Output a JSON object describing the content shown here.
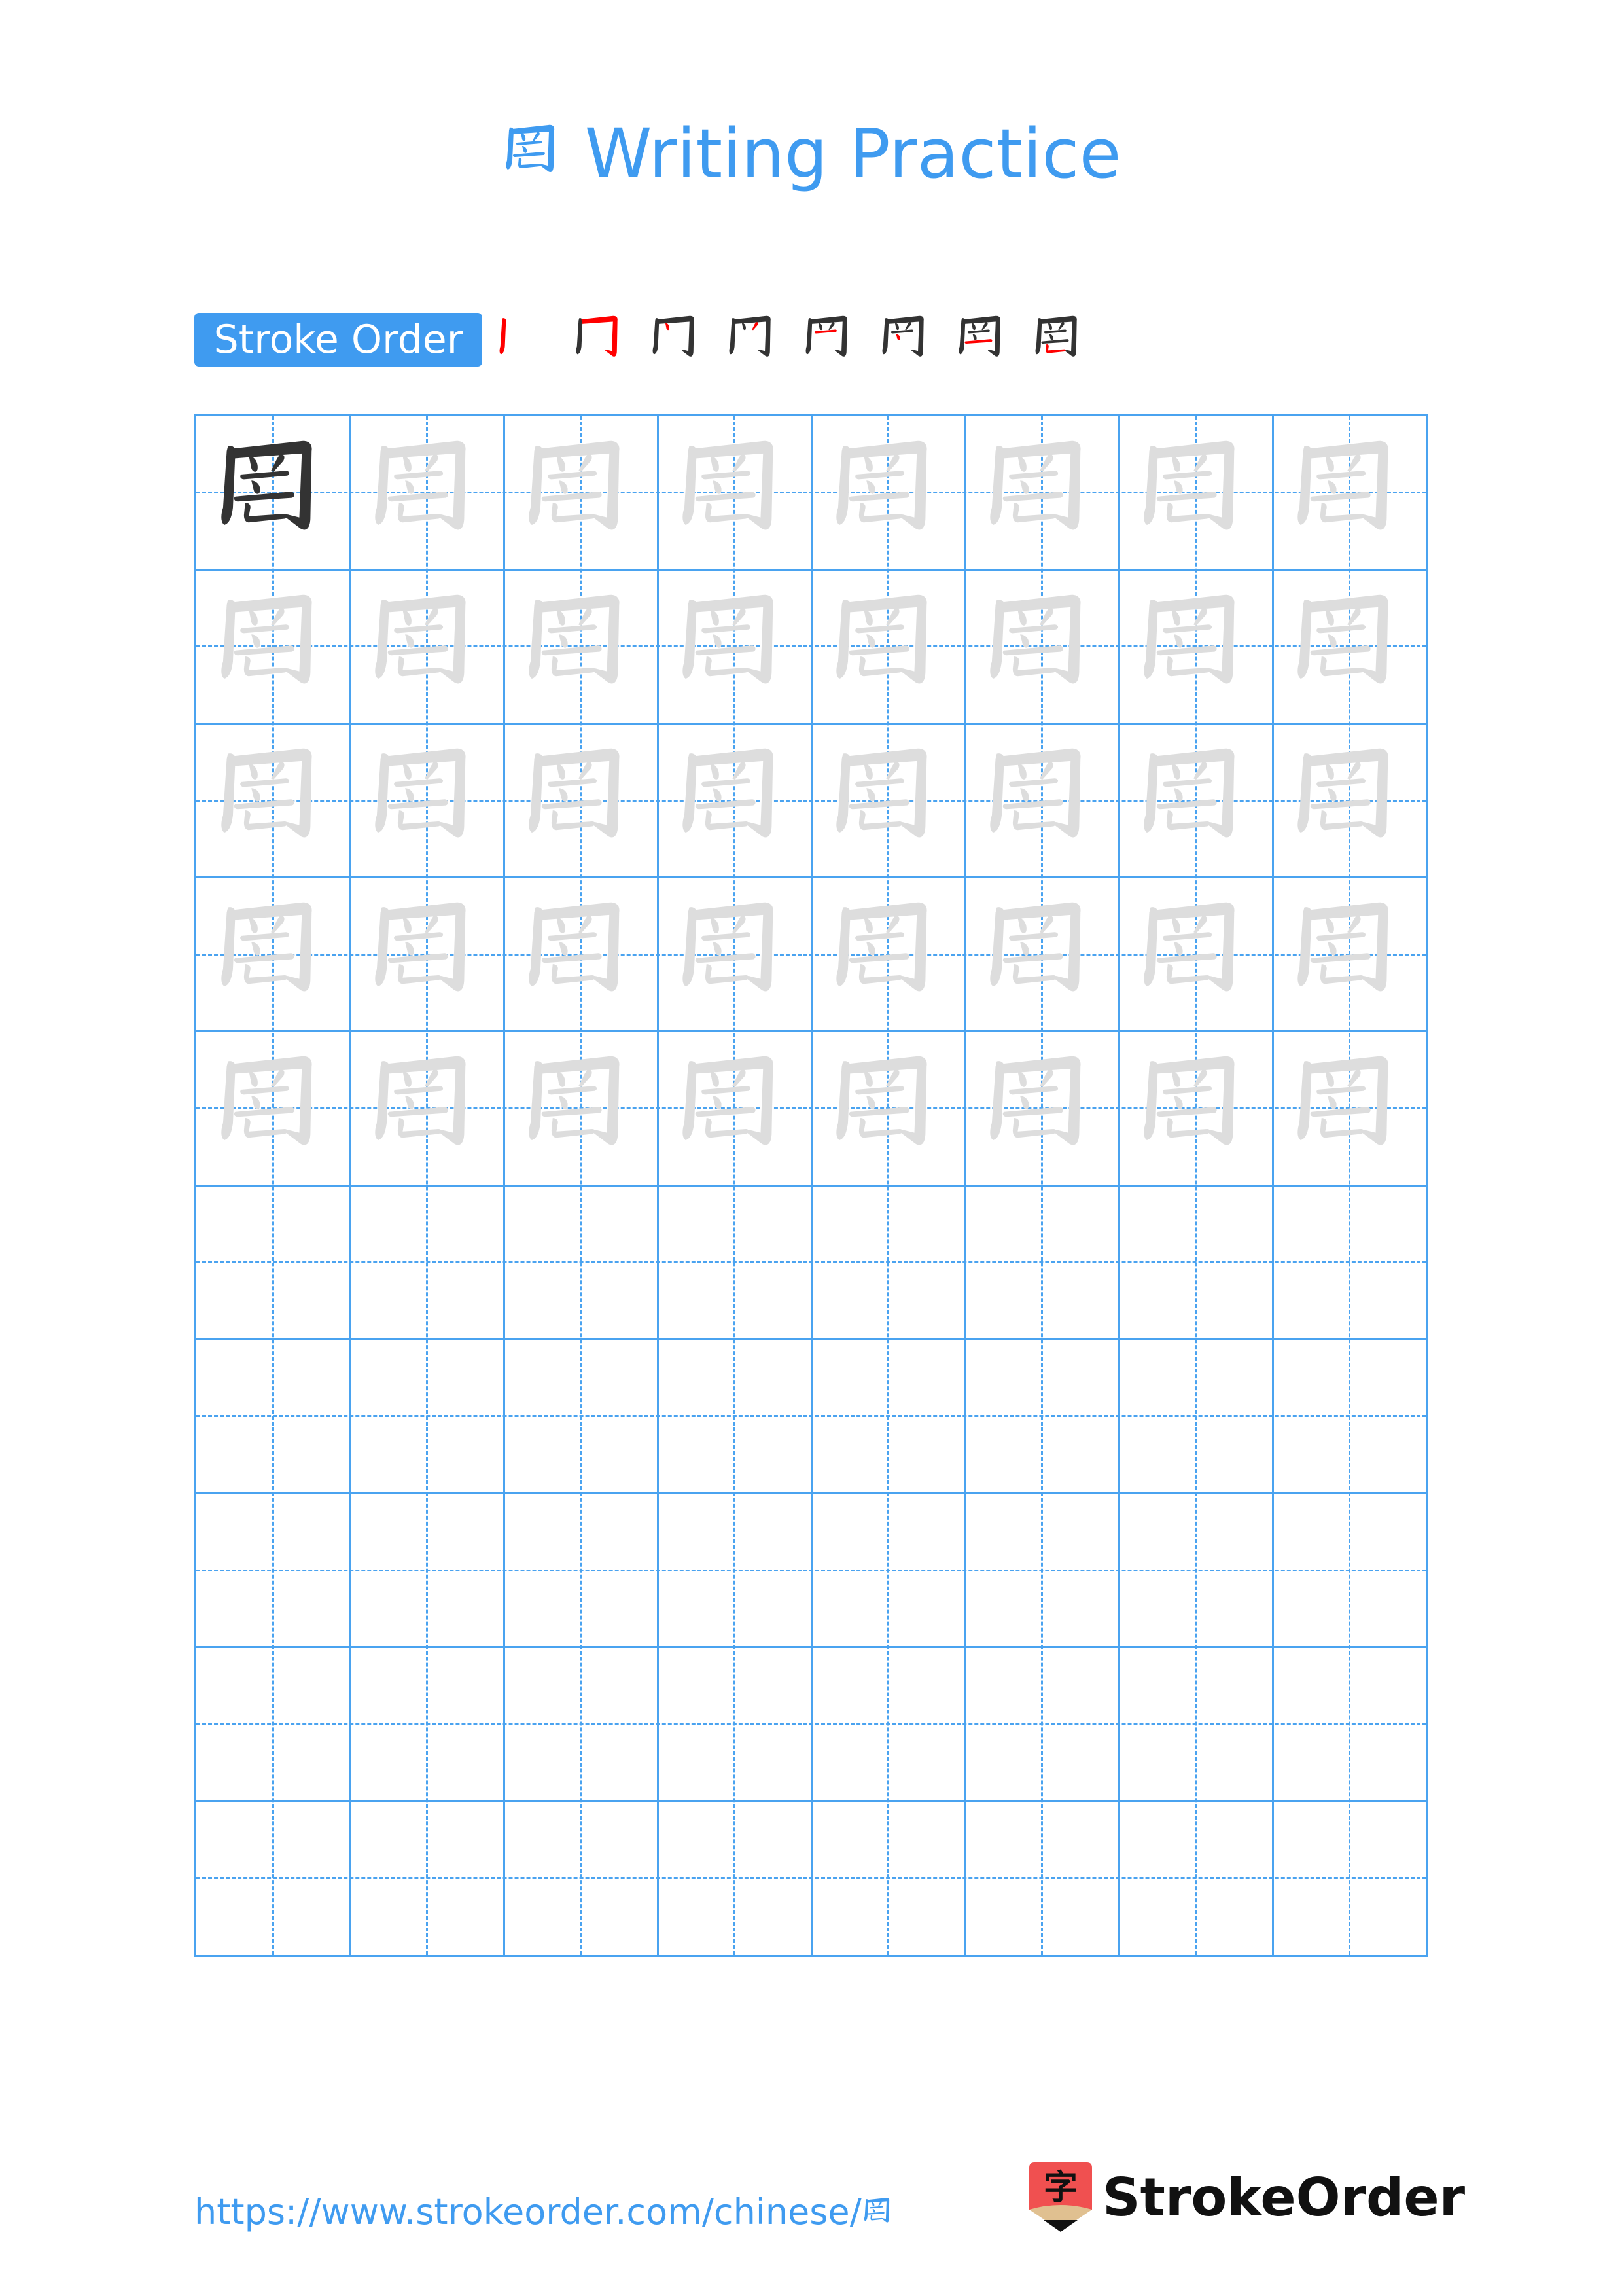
{
  "page": {
    "character": "罔",
    "title_suffix": "Writing Practice",
    "stroke_order_label": "Stroke Order",
    "stroke_count": 8,
    "footer_url_prefix": "https://www.strokeorder.com/chinese/",
    "footer_url_char": "罔",
    "logo_text": "StrokeOrder",
    "logo_icon_char": "字"
  },
  "colors": {
    "accent": "#3f9bf0",
    "grid_line": "#4aa3f0",
    "model_char": "#333333",
    "trace_char": "#dddddd",
    "current_stroke": "#ff0000",
    "logo_red": "#f05050",
    "logo_tan": "#e0c090"
  },
  "grid": {
    "columns": 8,
    "rows": 10,
    "model_cells": 1,
    "trace_rows": 5,
    "blank_rows": 5
  }
}
